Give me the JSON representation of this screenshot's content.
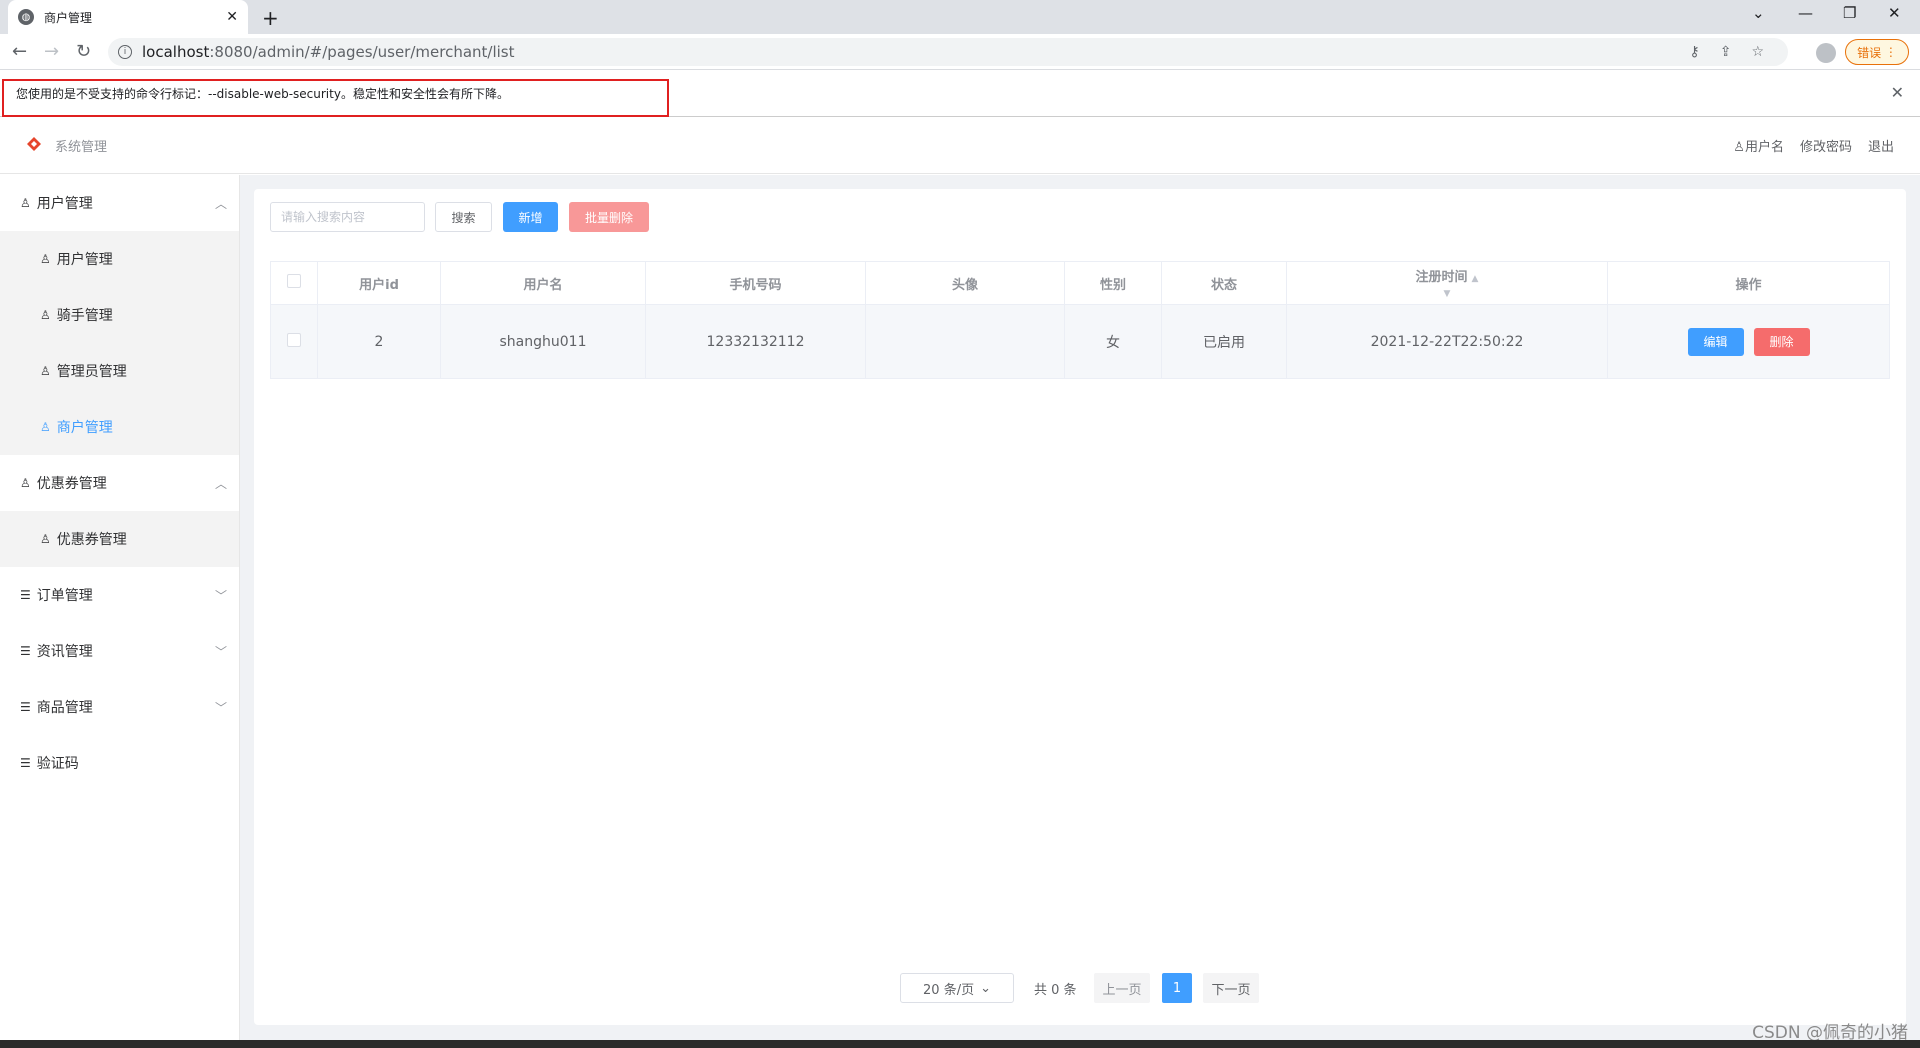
{
  "browser": {
    "tab_title": "商户管理",
    "url_host": "localhost",
    "url_rest": ":8080/admin/#/pages/user/merchant/list",
    "error_button": "错误",
    "infobar_message": "您使用的是不受支持的命令行标记：--disable-web-security。稳定性和安全性会有所下降。"
  },
  "header": {
    "system_title": "系统管理",
    "username": "用户名",
    "change_password": "修改密码",
    "logout": "退出"
  },
  "sidebar": {
    "items": [
      {
        "label": "用户管理",
        "level": 1,
        "icon": "user-icon",
        "arrow": "up"
      },
      {
        "label": "用户管理",
        "level": 2,
        "icon": "user-icon"
      },
      {
        "label": "骑手管理",
        "level": 2,
        "icon": "user-icon"
      },
      {
        "label": "管理员管理",
        "level": 2,
        "icon": "user-icon"
      },
      {
        "label": "商户管理",
        "level": 2,
        "icon": "user-icon",
        "active": true
      },
      {
        "label": "优惠券管理",
        "level": 1,
        "icon": "user-icon",
        "arrow": "up"
      },
      {
        "label": "优惠券管理",
        "level": 2,
        "icon": "user-icon"
      },
      {
        "label": "订单管理",
        "level": 1,
        "icon": "list-icon",
        "arrow": "down"
      },
      {
        "label": "资讯管理",
        "level": 1,
        "icon": "list-icon",
        "arrow": "down"
      },
      {
        "label": "商品管理",
        "level": 1,
        "icon": "list-icon",
        "arrow": "down"
      },
      {
        "label": "验证码",
        "level": 1,
        "icon": "list-icon"
      }
    ]
  },
  "toolbar": {
    "search_placeholder": "请输入搜索内容",
    "search_label": "搜索",
    "add_label": "新增",
    "batch_delete_label": "批量删除"
  },
  "table": {
    "headers": [
      "用户id",
      "用户名",
      "手机号码",
      "头像",
      "性别",
      "状态",
      "注册时间",
      "操作"
    ],
    "rows": [
      {
        "id": "2",
        "username": "shanghu011",
        "phone": "12332132112",
        "avatar": "",
        "gender": "女",
        "status": "已启用",
        "registered": "2021-12-22T22:50:22"
      }
    ],
    "edit_label": "编辑",
    "delete_label": "删除"
  },
  "pagination": {
    "page_size": "20 条/页",
    "total": "共 0 条",
    "prev": "上一页",
    "current": "1",
    "next": "下一页"
  },
  "watermark": "CSDN @佩奇的小猪",
  "colors": {
    "primary": "#409eff",
    "danger": "#f56c6c",
    "danger_light": "#f89898",
    "alert_red": "#e02020"
  }
}
